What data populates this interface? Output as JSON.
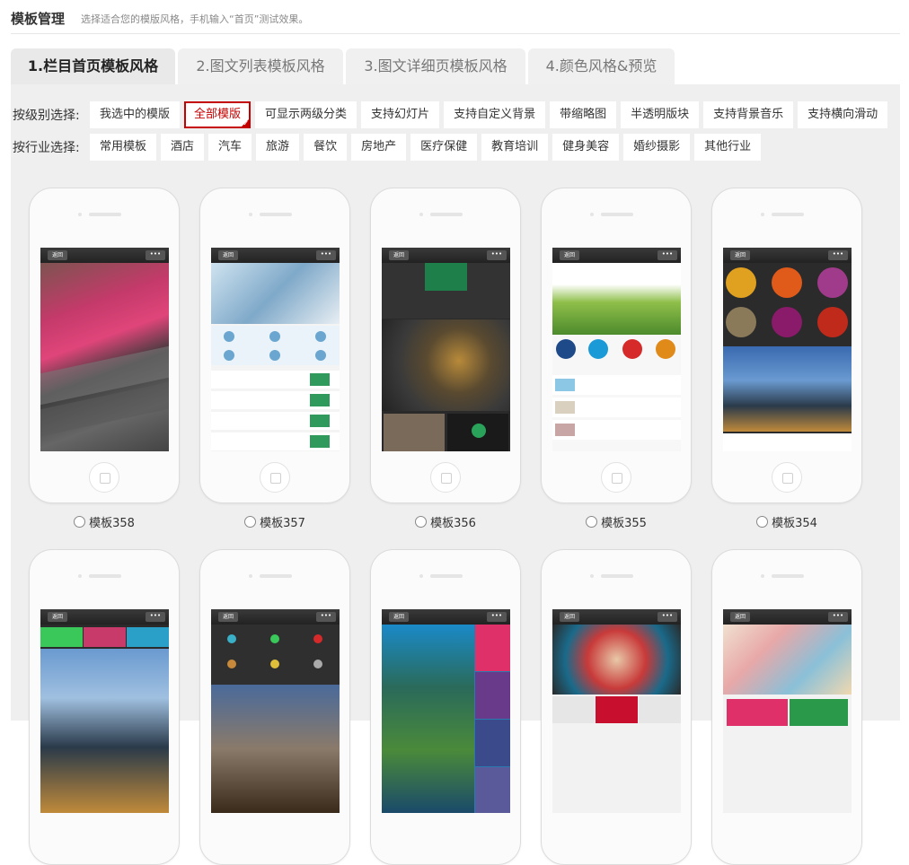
{
  "header": {
    "title": "模板管理",
    "hint": "选择适合您的模版风格，手机输入“首页”测试效果。"
  },
  "tabs": [
    {
      "label": "1.栏目首页模板风格",
      "active": true
    },
    {
      "label": "2.图文列表模板风格",
      "active": false
    },
    {
      "label": "3.图文详细页模板风格",
      "active": false
    },
    {
      "label": "4.颜色风格&预览",
      "active": false
    }
  ],
  "filters": {
    "level": {
      "label": "按级别选择:",
      "options": [
        "我选中的模版",
        "全部模版",
        "可显示两级分类",
        "支持幻灯片",
        "支持自定义背景",
        "带缩略图",
        "半透明版块",
        "支持背景音乐",
        "支持横向滑动"
      ],
      "selected_index": 1
    },
    "industry": {
      "label": "按行业选择:",
      "options": [
        "常用模板",
        "酒店",
        "汽车",
        "旅游",
        "餐饮",
        "房地产",
        "医疗保健",
        "教育培训",
        "健身美容",
        "婚纱摄影",
        "其他行业"
      ]
    }
  },
  "phone_ui": {
    "back": "返回",
    "more": "•••"
  },
  "templates": [
    {
      "label": "模板358"
    },
    {
      "label": "模板357"
    },
    {
      "label": "模板356"
    },
    {
      "label": "模板355"
    },
    {
      "label": "模板354"
    },
    {
      "label": ""
    },
    {
      "label": ""
    },
    {
      "label": ""
    },
    {
      "label": ""
    },
    {
      "label": ""
    }
  ],
  "colors": {
    "accent": "#c40000",
    "panel": "#efefef"
  }
}
